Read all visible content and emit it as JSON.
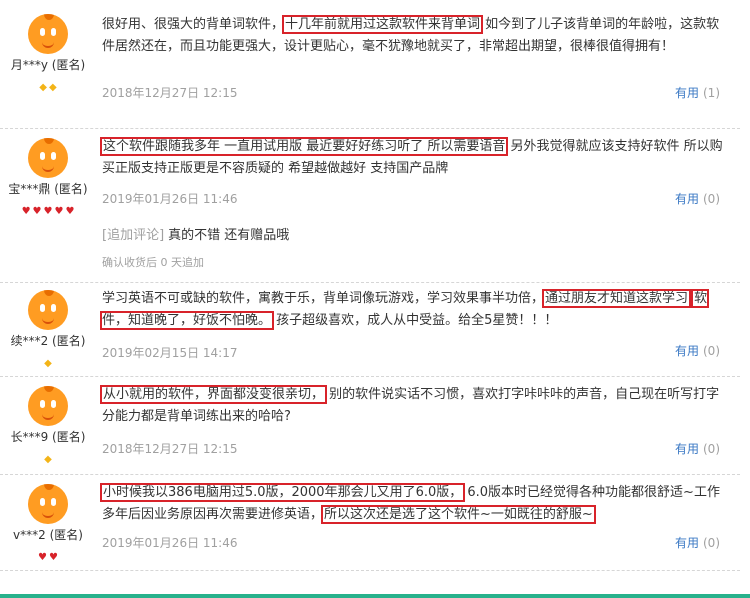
{
  "reviews": [
    {
      "user": "月***y (匿名)",
      "badges": [
        "diamond",
        "diamond"
      ],
      "segments": [
        {
          "t": "很好用、很强大的背单词软件，"
        },
        {
          "t": "十几年前就用过这款软件来背单词",
          "hl": true
        },
        {
          "t": " 如今到了儿子该背单词的年龄啦，这款软件居然还在，而且功能更强大，设计更贴心，毫不犹豫地就买了，非常超出期望，很棒很值得拥有！"
        }
      ],
      "date": "2018年12月27日  12:15",
      "useful": "有用",
      "count": "(1)"
    },
    {
      "user": "宝***鼎 (匿名)",
      "badges": [
        "heart",
        "heart",
        "heart",
        "heart",
        "heart"
      ],
      "segments": [
        {
          "t": "这个软件跟随我多年 一直用试用版 最近要好好练习听了 所以需要语音",
          "hl": true
        },
        {
          "t": " 另外我觉得就应该支持好软件 所以购买正版支持正版更是不容质疑的 希望越做越好 支持国产品牌"
        }
      ],
      "date": "2019年01月26日  11:46",
      "useful": "有用",
      "count": "(0)",
      "append": {
        "tag": "[追加评论]",
        "text": "真的不错 还有赠品哦",
        "meta": "确认收货后 0 天追加"
      }
    },
    {
      "user": "续***2 (匿名)",
      "badges": [
        "diamond"
      ],
      "segments": [
        {
          "t": "学习英语不可或缺的软件，寓教于乐，背单词像玩游戏，学习效果事半功倍，"
        },
        {
          "t": "通过朋友才知道这款学习",
          "hl": true
        },
        {
          "t": " "
        },
        {
          "t": "软件，知道晚了，好饭不怕晚。",
          "hl": true
        },
        {
          "t": " 孩子超级喜欢，成人从中受益。给全5星赞！！！"
        }
      ],
      "date": "2019年02月15日  14:17",
      "useful": "有用",
      "count": "(0)"
    },
    {
      "user": "长***9 (匿名)",
      "badges": [
        "diamond"
      ],
      "segments": [
        {
          "t": "从小就用的软件，界面都没变很亲切，",
          "hl": true
        },
        {
          "t": " 别的软件说实话不习惯，喜欢打字咔咔咔的声音，自己现在听写打字分能力都是背单词练出来的哈哈?"
        }
      ],
      "date": "2018年12月27日  12:15",
      "useful": "有用",
      "count": "(0)"
    },
    {
      "user": "v***2 (匿名)",
      "badges": [
        "heart",
        "heart"
      ],
      "segments": [
        {
          "t": "小时候我以386电脑用过5.0版，2000年那会儿又用了6.0版，",
          "hl": true
        },
        {
          "t": " 6.0版本时已经觉得各种功能都很舒适~工作多年后因业务原因再次需要进修英语，"
        },
        {
          "t": "所以这次还是选了这个软件~一如既往的舒服~",
          "hl": true
        }
      ],
      "date": "2019年01月26日  11:46",
      "useful": "有用",
      "count": "(0)"
    }
  ]
}
